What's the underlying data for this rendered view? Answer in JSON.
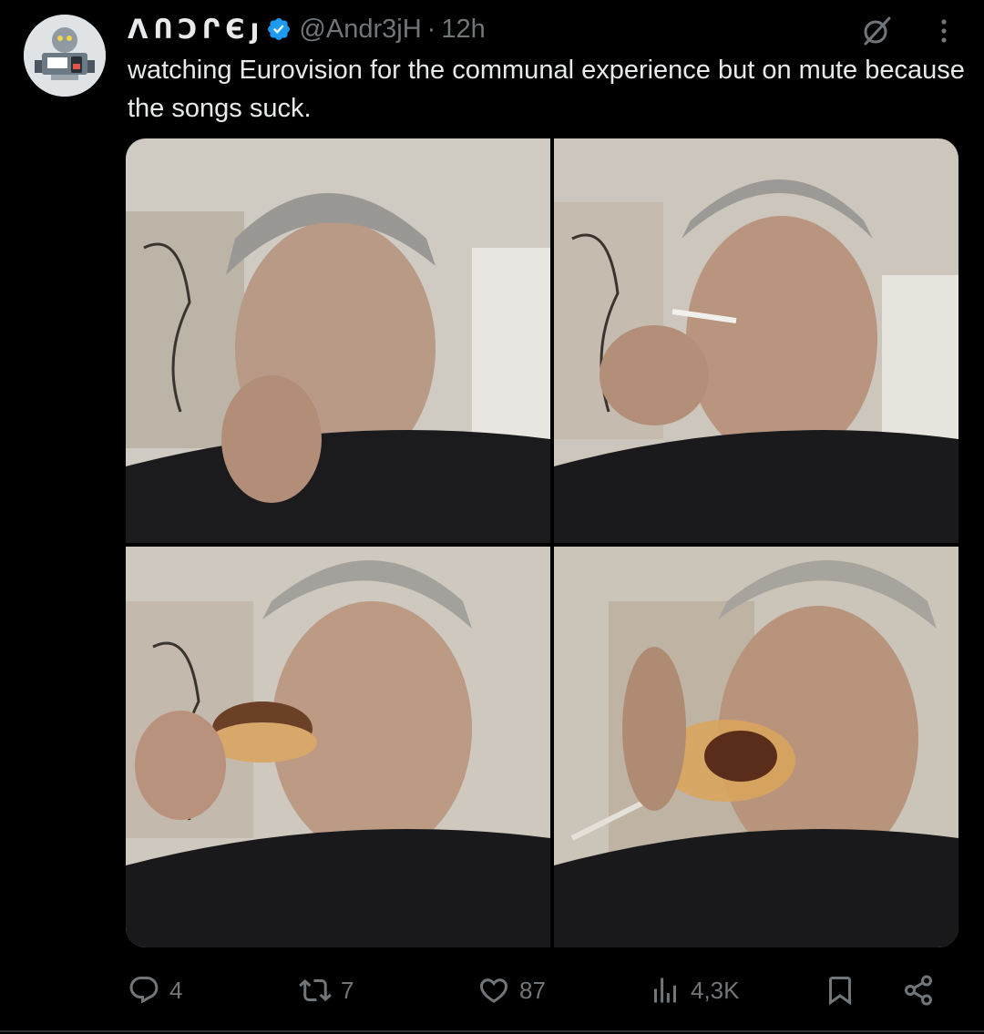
{
  "tweet": {
    "display_name": "ΛՈϽՐЄȷ",
    "handle": "@Andr3jH",
    "separator": "·",
    "timestamp": "12h",
    "text": "watching Eurovision for the communal experience but on mute because the songs suck."
  },
  "media": {
    "image_count": 4
  },
  "actions": {
    "replies": "4",
    "reposts": "7",
    "likes": "87",
    "views": "4,3K"
  },
  "icons": {
    "verified": "verified-badge-icon",
    "grok": "grok-icon",
    "more": "more-vertical-icon",
    "reply": "reply-icon",
    "repost": "repost-icon",
    "like": "heart-icon",
    "views": "views-chart-icon",
    "bookmark": "bookmark-icon",
    "share": "share-icon"
  },
  "colors": {
    "background": "#000000",
    "text_primary": "#e7e9ea",
    "text_secondary": "#71767b",
    "verified": "#1d9bf0"
  }
}
